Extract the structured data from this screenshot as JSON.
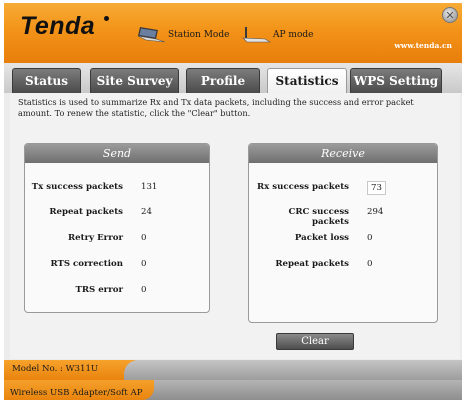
{
  "header": {
    "logo": "Tenda",
    "station_mode_label": "Station Mode",
    "ap_mode_label": "AP mode",
    "site": "www.tenda.cn",
    "close_glyph": "✕"
  },
  "tabs": [
    {
      "label": "Status"
    },
    {
      "label": "Site Survey"
    },
    {
      "label": "Profile"
    },
    {
      "label": "Statistics"
    },
    {
      "label": "WPS Setting"
    }
  ],
  "active_tab": "Statistics",
  "description": "Statistics is used to summarize Rx and Tx data packets, including the success and error packet amount. To renew the statistic, click the \"Clear\" button.",
  "send": {
    "title": "Send",
    "rows": [
      {
        "label": "Tx success packets",
        "value": "131"
      },
      {
        "label": "Repeat packets",
        "value": "24"
      },
      {
        "label": "Retry Error",
        "value": "0"
      },
      {
        "label": "RTS correction",
        "value": "0"
      },
      {
        "label": "TRS error",
        "value": "0"
      }
    ]
  },
  "receive": {
    "title": "Receive",
    "rows": [
      {
        "label": "Rx success packets",
        "value": "73"
      },
      {
        "label": "CRC success packets",
        "value": "294"
      },
      {
        "label": "Packet loss",
        "value": "0"
      },
      {
        "label": "Repeat packets",
        "value": "0"
      }
    ]
  },
  "clear_button": "Clear",
  "footer": {
    "model": "Model No. : W311U",
    "product": "Wireless USB Adapter/Soft AP"
  },
  "colors": {
    "brand_orange": "#f39318",
    "tab_dark": "#4b4b4b",
    "panel_header": "#7f7f7f"
  },
  "icons": {
    "station": "laptop-icon",
    "ap": "laptop-icon",
    "close": "close-icon"
  }
}
